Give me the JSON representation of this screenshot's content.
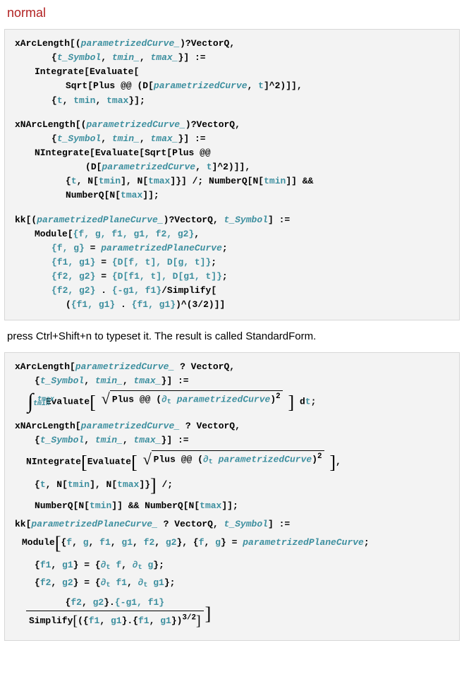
{
  "title": "normal",
  "instruction": "press Ctrl+Shift+n to typeset it. The result is called StandardForm.",
  "code1": {
    "fnA": "xArcLength",
    "fnB": "xNArcLength",
    "fnC": "kk",
    "argCurve": "parametrizedCurve_",
    "argPlaneCurve": "parametrizedPlaneCurve_",
    "curveBare": "parametrizedCurve",
    "planeCurveBare": "parametrizedPlaneCurve",
    "vecq": "?VectorQ",
    "tsym": "t_Symbol",
    "tmin": "tmin_",
    "tmax": "tmax_",
    "t": "t",
    "tminBare": "tmin",
    "tmaxBare": "tmax",
    "assign": ":=",
    "integrate": "Integrate",
    "nintegrate": "NIntegrate",
    "evaluate": "Evaluate",
    "sqrt": "Sqrt",
    "plus": "Plus",
    "apply": "@@",
    "d": "D",
    "pow2": "^2",
    "semicolon": ";",
    "condition": "/;",
    "numberq": "NumberQ",
    "nfn": "N",
    "and": "&&",
    "module": "Module",
    "modulevars": "{f, g, f1, g1, f2, g2}",
    "fg": "{f, g}",
    "eq": "=",
    "f1g1": "{f1, g1}",
    "f2g2": "{f2, g2}",
    "dlist1": "{D[f, t], D[g, t]}",
    "dlist2": "{D[f1, t], D[g1, t]}",
    "dot": ".",
    "neglist": "{-g1, f1}",
    "simplify": "Simplify",
    "pow32": "^(3/2)"
  },
  "code2": {
    "fnA": "xArcLength",
    "fnB": "xNArcLength",
    "fnC": "kk",
    "argCurve": "parametrizedCurve_",
    "argPlaneCurve": "parametrizedPlaneCurve_",
    "curveBare": "parametrizedCurve",
    "planeCurveBare": "parametrizedPlaneCurve",
    "vecq": "? VectorQ",
    "tsym": "t_Symbol",
    "tmin": "tmin_",
    "tmax": "tmax_",
    "t": "t",
    "tminBare": "tmin",
    "tmaxBare": "tmax",
    "assign": ":=",
    "integrate": "Integrate",
    "nintegrate": "NIntegrate",
    "evaluate": "Evaluate",
    "plus": "Plus",
    "apply": "@@",
    "partial": "∂",
    "pow2": "2",
    "dtsym": "d",
    "semicolon": ";",
    "condition": "/;",
    "numberq": "NumberQ",
    "nfn": "N",
    "and": "&&",
    "module": "Module",
    "f": "f",
    "g": "g",
    "f1": "f1",
    "g1": "g1",
    "f2": "f2",
    "g2": "g2",
    "eq": "=",
    "dot": ".",
    "neglist": "{-g1, f1}",
    "simplify": "Simplify",
    "pow32": "3/2"
  }
}
